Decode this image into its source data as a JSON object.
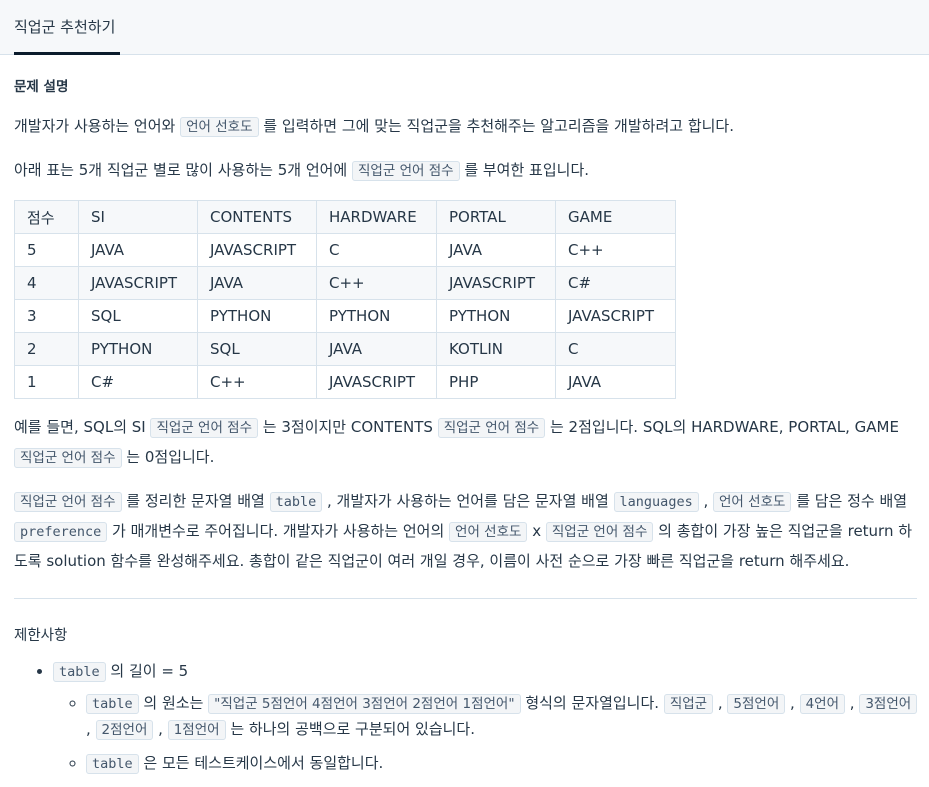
{
  "tab": {
    "title": "직업군 추천하기"
  },
  "description": {
    "heading": "문제 설명",
    "p1": {
      "a": "개발자가 사용하는 언어와 ",
      "code": "언어 선호도",
      "b": " 를 입력하면 그에 맞는 직업군을 추천해주는 알고리즘을 개발하려고 합니다."
    },
    "p2": {
      "a": "아래 표는 5개 직업군 별로 많이 사용하는 5개 언어에 ",
      "code": "직업군 언어 점수",
      "b": " 를 부여한 표입니다."
    },
    "table": {
      "headers": [
        "점수",
        "SI",
        "CONTENTS",
        "HARDWARE",
        "PORTAL",
        "GAME"
      ],
      "rows": [
        [
          "5",
          "JAVA",
          "JAVASCRIPT",
          "C",
          "JAVA",
          "C++"
        ],
        [
          "4",
          "JAVASCRIPT",
          "JAVA",
          "C++",
          "JAVASCRIPT",
          "C#"
        ],
        [
          "3",
          "SQL",
          "PYTHON",
          "PYTHON",
          "PYTHON",
          "JAVASCRIPT"
        ],
        [
          "2",
          "PYTHON",
          "SQL",
          "JAVA",
          "KOTLIN",
          "C"
        ],
        [
          "1",
          "C#",
          "C++",
          "JAVASCRIPT",
          "PHP",
          "JAVA"
        ]
      ]
    },
    "p3": {
      "a": "예를 들면, SQL의 SI ",
      "code1": "직업군 언어 점수",
      "b": " 는 3점이지만 CONTENTS ",
      "code2": "직업군 언어 점수",
      "c": " 는 2점입니다. SQL의 HARDWARE, PORTAL, GAME ",
      "code3": "직업군 언어 점수",
      "d": " 는 0점입니다."
    },
    "p4": {
      "code1": "직업군 언어 점수",
      "a": " 를 정리한 문자열 배열 ",
      "code2": "table",
      "b": " , 개발자가 사용하는 언어를 담은 문자열 배열 ",
      "code3": "languages",
      "c": " , ",
      "code4": "언어 선호도",
      "d": " 를 담은 정수 배열 ",
      "code5": "preference",
      "e": " 가 매개변수로 주어집니다. 개발자가 사용하는 언어의 ",
      "code6": "언어 선호도",
      "f": " x ",
      "code7": "직업군 언어 점수",
      "g": " 의 총합이 가장 높은 직업군을 return 하도록 solution 함수를 완성해주세요. 총합이 같은 직업군이 여러 개일 경우, 이름이 사전 순으로 가장 빠른 직업군을 return 해주세요."
    }
  },
  "constraints": {
    "heading": "제한사항",
    "item1": {
      "code": "table",
      "text": " 의 길이 = 5"
    },
    "sub1": {
      "code1": "table",
      "a": " 의 원소는 ",
      "code2": "\"직업군 5점언어 4점언어 3점언어 2점언어 1점언어\"",
      "b": " 형식의 문자열입니다. ",
      "code3": "직업군",
      "c": " , ",
      "code4": "5점언어",
      "d": " , ",
      "code5": "4언어",
      "e": " , ",
      "code6": "3점언어",
      "f": " , ",
      "code7": "2점언어",
      "g": " , ",
      "code8": "1점언어",
      "h": " 는 하나의 공백으로 구분되어 있습니다."
    },
    "sub2": {
      "code": "table",
      "text": " 은 모든 테스트케이스에서 동일합니다."
    }
  }
}
